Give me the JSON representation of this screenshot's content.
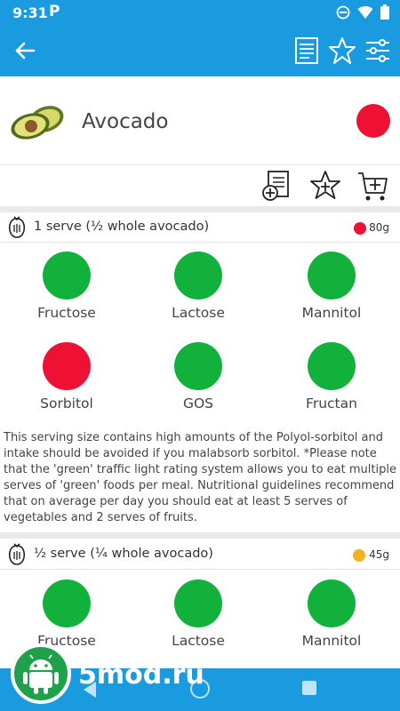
{
  "status_bar": {
    "time": "9:31",
    "app_indicator": "P",
    "icons": [
      "do-not-disturb-icon",
      "wifi-icon",
      "battery-icon"
    ]
  },
  "app_bar": {
    "back_icon": "arrow-back-icon",
    "actions": [
      "document-icon",
      "star-outline-icon",
      "filter-sliders-icon"
    ]
  },
  "food": {
    "name": "Avocado",
    "overall_rating_color": "#ee1133"
  },
  "actions": [
    "add-to-meal-icon",
    "add-favourite-icon",
    "add-to-cart-icon"
  ],
  "servings": [
    {
      "label": "1 serve (½ whole avocado)",
      "weight": "80g",
      "rating_color": "#ee1133",
      "nutrients": [
        {
          "name": "Fructose",
          "rating": "green"
        },
        {
          "name": "Lactose",
          "rating": "green"
        },
        {
          "name": "Mannitol",
          "rating": "green"
        },
        {
          "name": "Sorbitol",
          "rating": "red"
        },
        {
          "name": "GOS",
          "rating": "green"
        },
        {
          "name": "Fructan",
          "rating": "green"
        }
      ],
      "note": "This serving size contains high amounts of the Polyol-sorbitol and intake should be avoided if you malabsorb sorbitol. *Please note that the 'green' traffic light rating system allows you to eat multiple serves of 'green' foods per meal. Nutritional guidelines recommend that on average per day you should eat at least 5 serves of vegetables and 2 serves of fruits."
    },
    {
      "label": "½ serve (¼ whole avocado)",
      "weight": "45g",
      "rating_color": "#f2b321",
      "nutrients": [
        {
          "name": "Fructose",
          "rating": "green"
        },
        {
          "name": "Lactose",
          "rating": "green"
        },
        {
          "name": "Mannitol",
          "rating": "green"
        }
      ]
    }
  ],
  "watermark": {
    "text": "5mod.ru",
    "icon": "android-robot-icon"
  },
  "nav_bar": {
    "icons": [
      "nav-back-icon",
      "nav-home-icon",
      "nav-recents-icon"
    ]
  }
}
